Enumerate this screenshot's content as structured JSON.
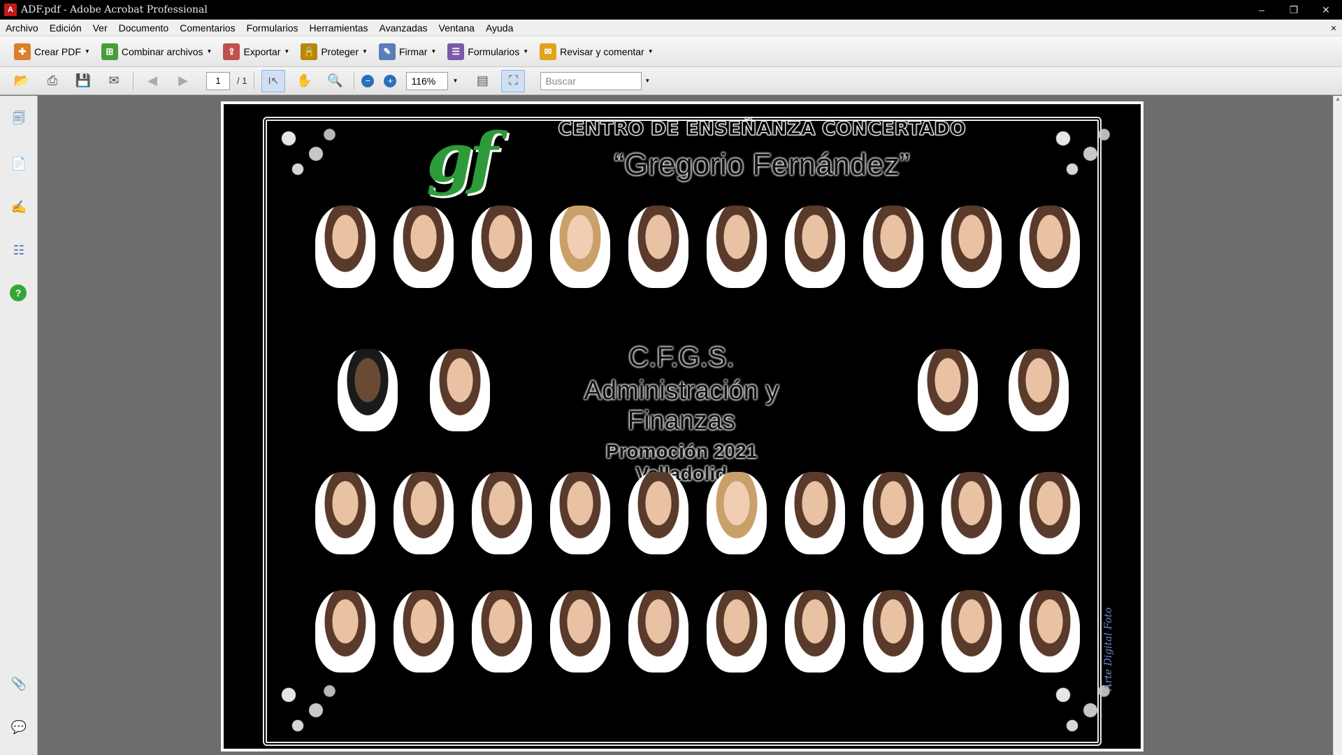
{
  "window": {
    "title": "ADF.pdf - Adobe Acrobat Professional",
    "app_icon": "pdf-icon",
    "buttons": [
      "minimize",
      "maximize",
      "close"
    ]
  },
  "menubar": {
    "items": [
      "Archivo",
      "Edición",
      "Ver",
      "Documento",
      "Comentarios",
      "Formularios",
      "Herramientas",
      "Avanzadas",
      "Ventana",
      "Ayuda"
    ],
    "close_symbol": "×"
  },
  "tasks": {
    "items": [
      {
        "label": "Crear PDF",
        "icon": "create-pdf-icon",
        "color": "#d9822b"
      },
      {
        "label": "Combinar archivos",
        "icon": "combine-files-icon",
        "color": "#4a9c3b"
      },
      {
        "label": "Exportar",
        "icon": "export-icon",
        "color": "#c0504d"
      },
      {
        "label": "Proteger",
        "icon": "lock-icon",
        "color": "#b8860b"
      },
      {
        "label": "Firmar",
        "icon": "pen-icon",
        "color": "#5b7db8"
      },
      {
        "label": "Formularios",
        "icon": "forms-icon",
        "color": "#7a5aa8"
      },
      {
        "label": "Revisar y comentar",
        "icon": "comment-icon",
        "color": "#e0a31c"
      }
    ]
  },
  "toolbar": {
    "page_current": "1",
    "page_total": "/ 1",
    "zoom": "116%",
    "search_placeholder": "Buscar"
  },
  "document": {
    "heading1": "CENTRO DE ENSEÑANZA CONCERTADO",
    "heading2": "“Gregorio Fernández”",
    "logo_text": "gf",
    "course_line1": "C.F.G.S.",
    "course_line2": "Administración y Finanzas",
    "course_line3": "Promoción 2021",
    "course_line4": "Valladolid",
    "signature": "Arte Digital Foto"
  }
}
